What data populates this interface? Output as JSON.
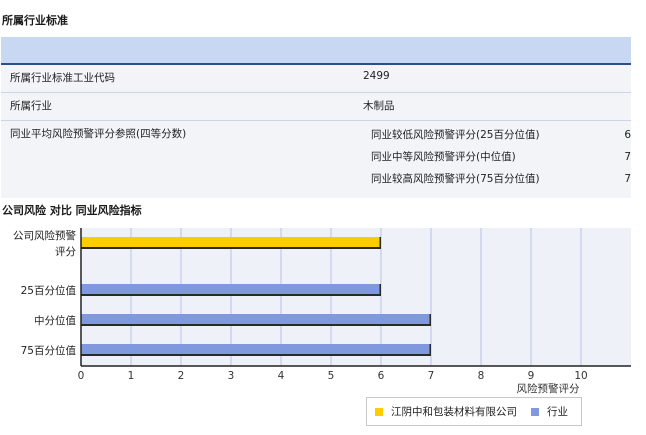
{
  "info": {
    "title": "所属行业标准",
    "rows": [
      {
        "label": "所属行业标准工业代码",
        "value": "2499"
      },
      {
        "label": "所属行业",
        "value": "木制品"
      }
    ],
    "ref": {
      "label": "同业平均风险预警评分参照(四等分数)",
      "items": [
        {
          "label": "同业较低风险预警评分(25百分位值)",
          "value": "6"
        },
        {
          "label": "同业中等风险预警评分(中位值)",
          "value": "7"
        },
        {
          "label": "同业较高风险预警评分(75百分位值)",
          "value": "7"
        }
      ]
    }
  },
  "chart_title": "公司风险 对比 同业风险指标",
  "chart_data": {
    "type": "bar",
    "orientation": "horizontal",
    "categories": [
      "公司风险预警评分",
      "25百分位值",
      "中分位值",
      "75百分位值"
    ],
    "category_display": [
      [
        "公司风险预警",
        "评分"
      ],
      [
        "25百分位值"
      ],
      [
        "中分位值"
      ],
      [
        "75百分位值"
      ]
    ],
    "values": [
      6,
      6,
      7,
      7
    ],
    "bar_series": [
      "company",
      "industry",
      "industry",
      "industry"
    ],
    "series": [
      {
        "name": "江阴中和包装材料有限公司",
        "color": "#ffcc00"
      },
      {
        "name": "行业",
        "color": "#7f98de"
      }
    ],
    "xlabel": "风险预警评分",
    "xlim": [
      0,
      11
    ],
    "xticks": [
      0,
      1,
      2,
      3,
      4,
      5,
      6,
      7,
      8,
      9,
      10
    ],
    "grid": true,
    "legend": "bottom"
  }
}
